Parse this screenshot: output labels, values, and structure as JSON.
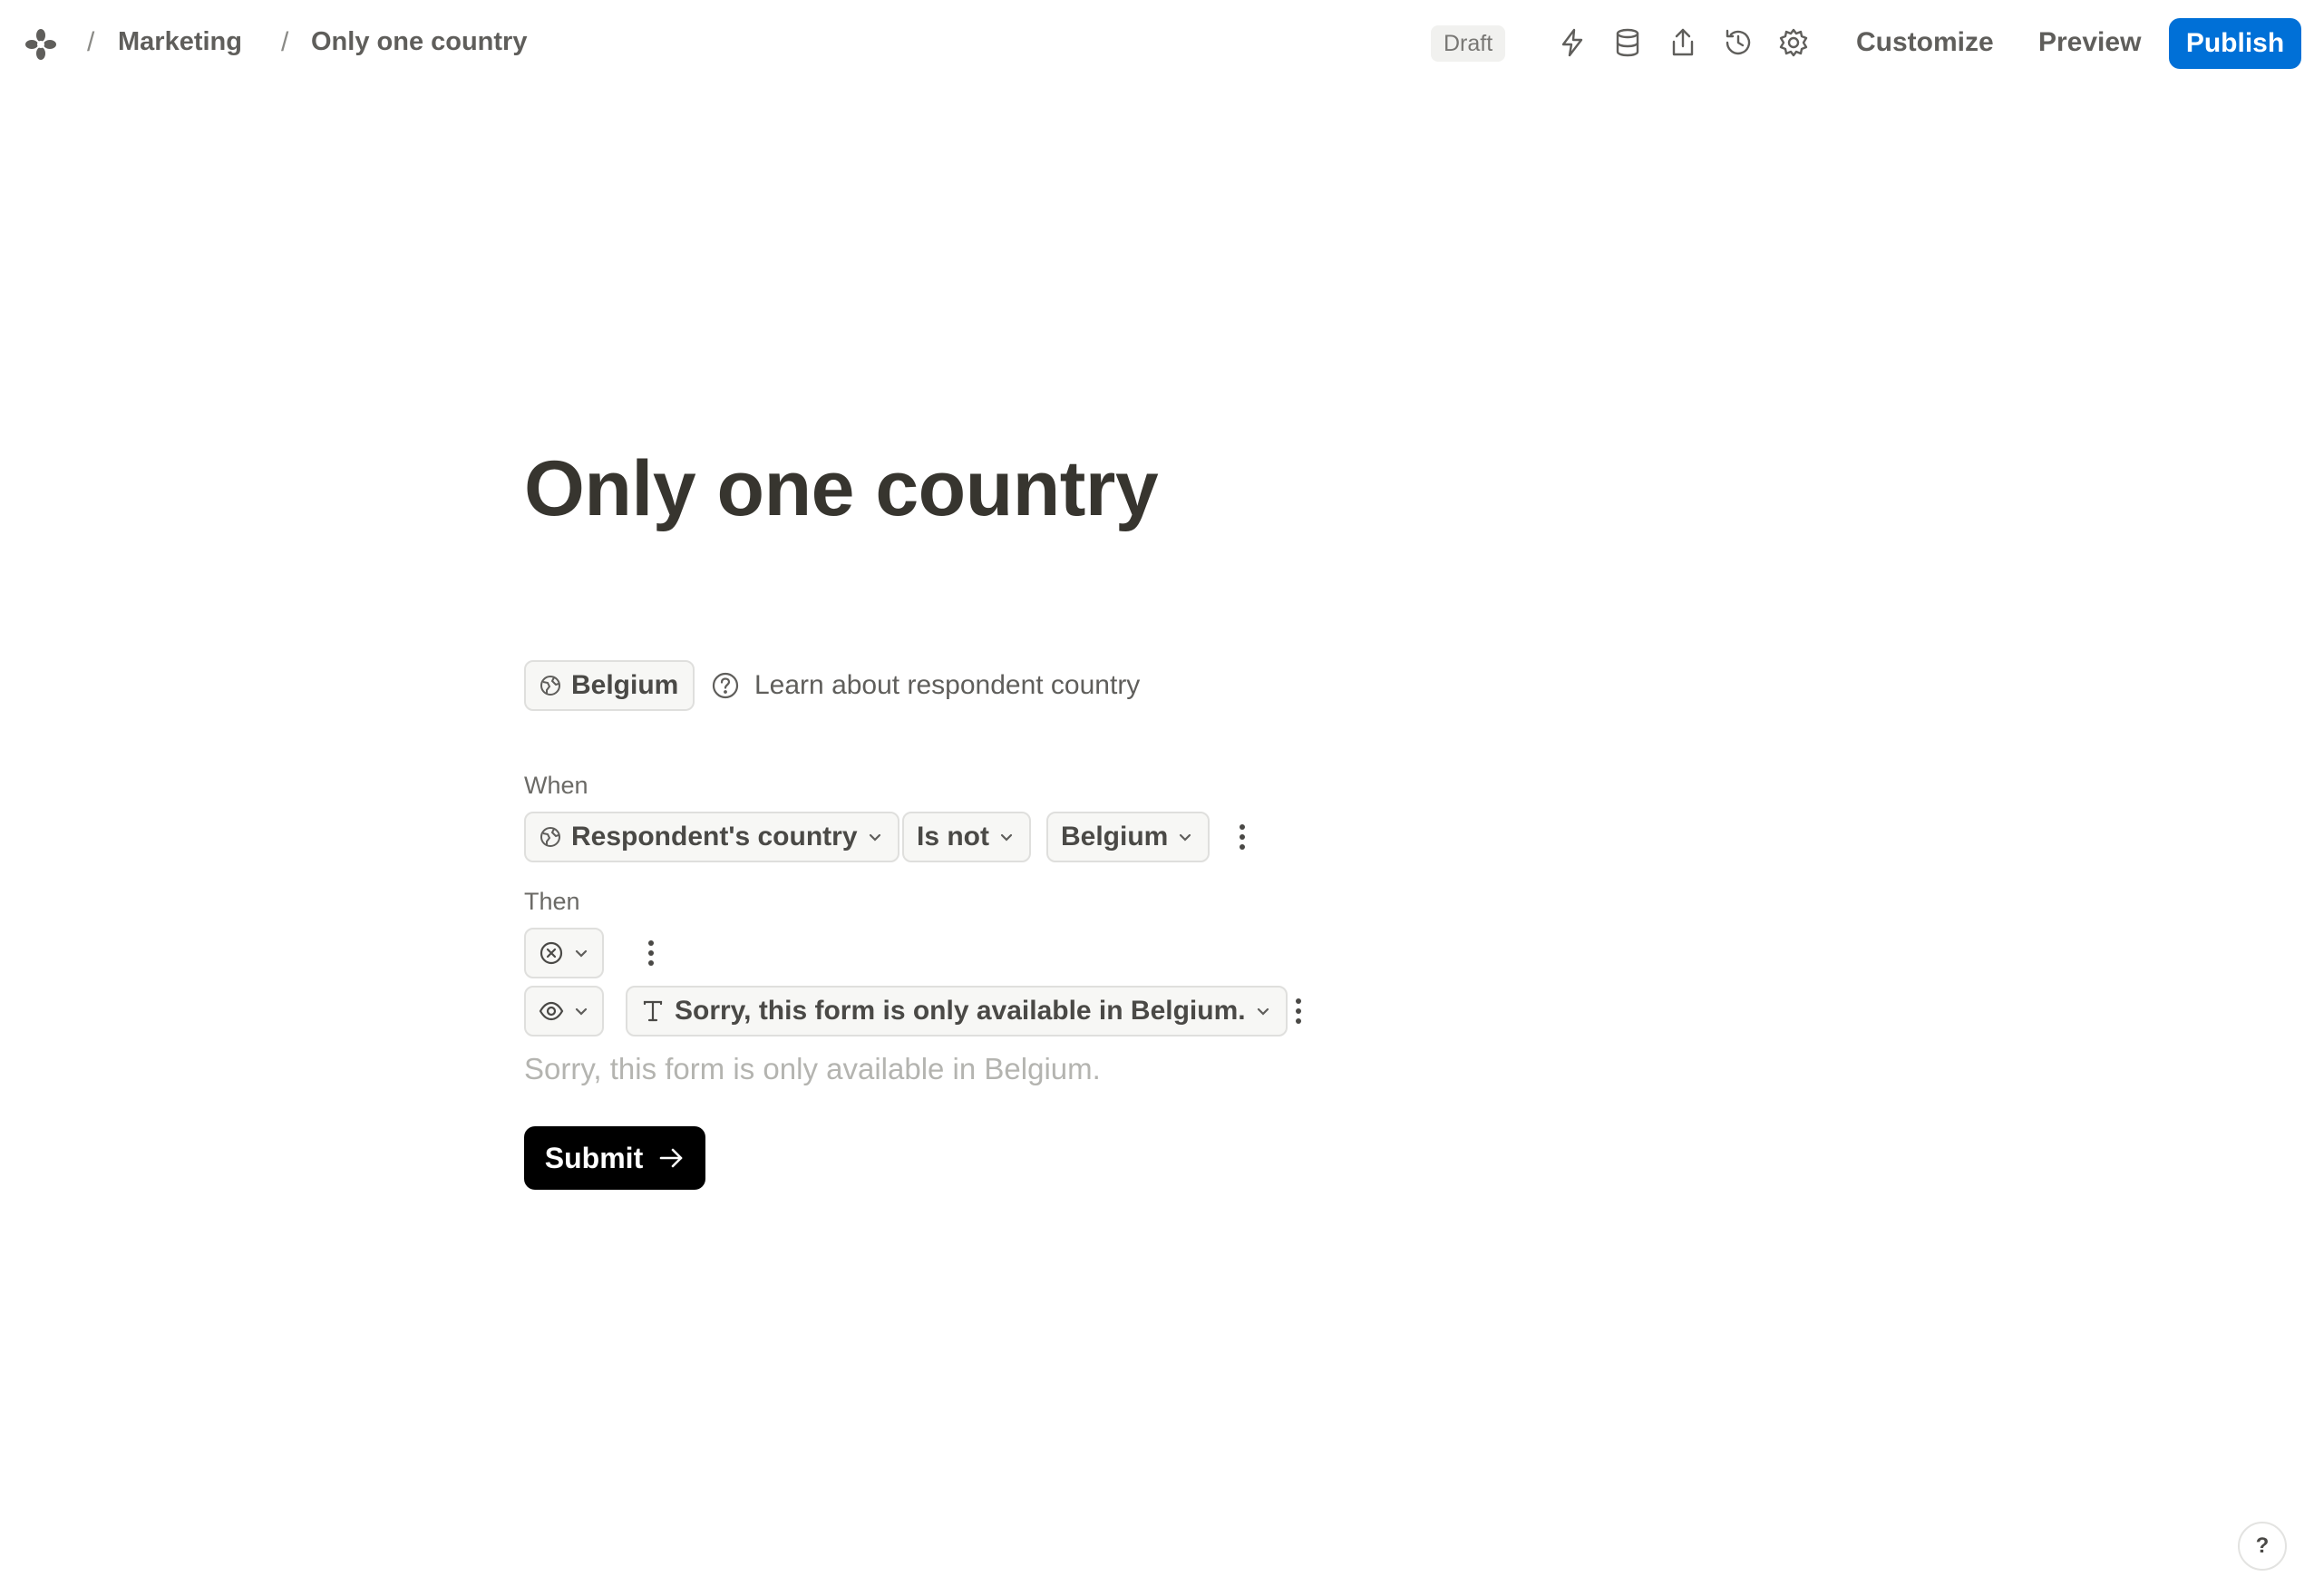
{
  "breadcrumb": {
    "separator": "/",
    "workspace": "Marketing",
    "form": "Only one country"
  },
  "toolbar": {
    "status": "Draft",
    "icons": [
      "lightning-icon",
      "database-icon",
      "share-icon",
      "history-icon",
      "gear-icon"
    ],
    "customize": "Customize",
    "preview": "Preview",
    "publish": "Publish",
    "accent_color": "#0070d7"
  },
  "form": {
    "title": "Only one country",
    "country_badge": "Belgium",
    "learn_link": "Learn about respondent country",
    "logic": {
      "when_label": "When",
      "condition": {
        "field": "Respondent's country",
        "operator": "Is not",
        "value": "Belgium"
      },
      "then_label": "Then",
      "action_message": "Sorry, this form is only available in Belgium."
    },
    "message_placeholder": "Sorry, this form is only available in Belgium.",
    "submit": "Submit"
  },
  "help": "?"
}
